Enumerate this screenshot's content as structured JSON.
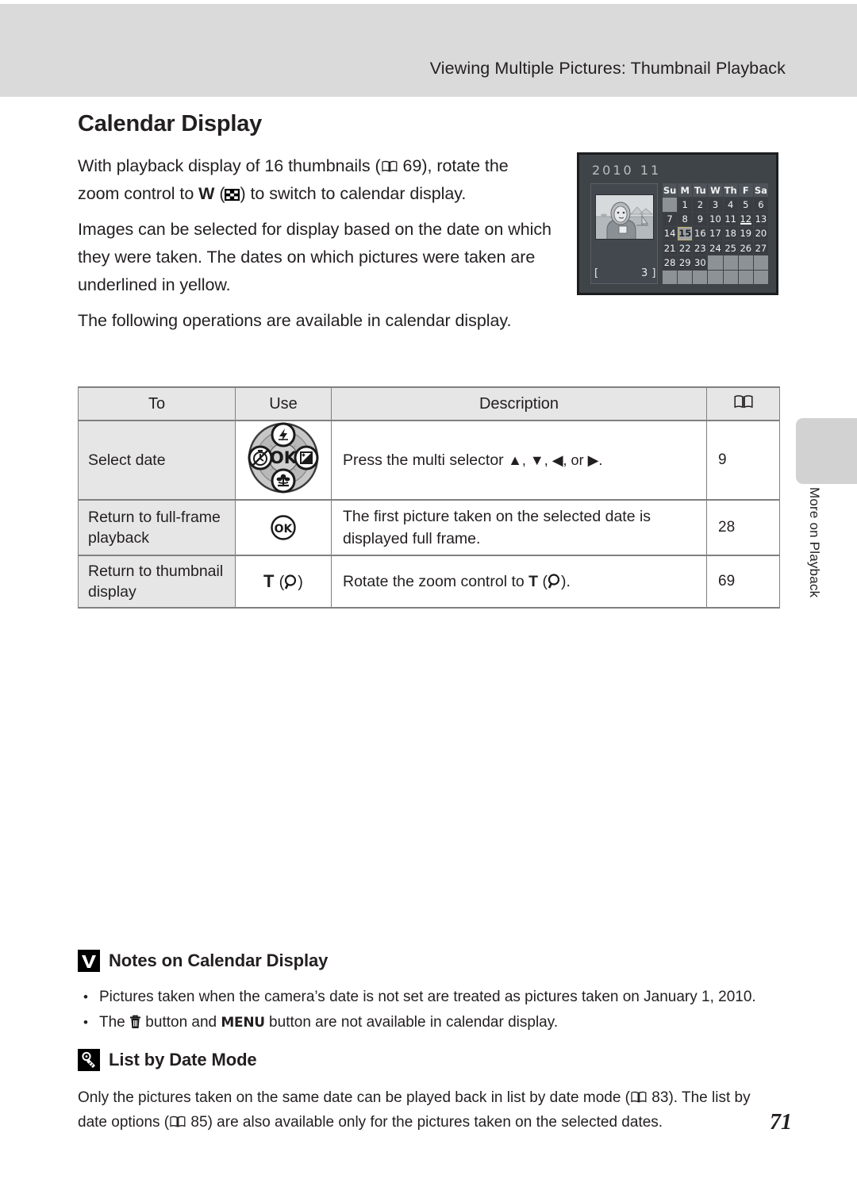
{
  "header": {
    "running_title": "Viewing Multiple Pictures: Thumbnail Playback"
  },
  "side_tab": {
    "label": "More on Playback"
  },
  "section": {
    "title": "Calendar Display",
    "paragraphs": [
      {
        "id": "p1",
        "pre": "With playback display of 16 thumbnails (",
        "bookref_page": "69",
        "mid": "), rotate the zoom control to ",
        "w_label": "W",
        "mid2": " (",
        "post": ") to switch to calendar display."
      },
      {
        "id": "p2",
        "text": "Images can be selected for display based on the date on which they were taken. The dates on which pictures were taken are underlined in yellow."
      },
      {
        "id": "p3",
        "text": "The following operations are available in calendar display."
      }
    ]
  },
  "camera_screenshot": {
    "year": "2010",
    "month": "11",
    "picture_count_open": "[",
    "picture_count": "3",
    "picture_count_close": "]",
    "weekday_headers": [
      "Su",
      "M",
      "Tu",
      "W",
      "Th",
      "F",
      "Sa"
    ],
    "leading_blanks": 1,
    "days": [
      1,
      2,
      3,
      4,
      5,
      6,
      7,
      8,
      9,
      10,
      11,
      12,
      13,
      14,
      15,
      16,
      17,
      18,
      19,
      20,
      21,
      22,
      23,
      24,
      25,
      26,
      27,
      28,
      29,
      30
    ],
    "selected_day": 15,
    "underlined_days": [
      12
    ],
    "total_cells": 49
  },
  "table": {
    "headers": [
      "To",
      "Use",
      "Description",
      "book-icon"
    ],
    "rows": [
      {
        "to": "Select date",
        "use_icon": "multi-selector-dial-icon",
        "use_label": "",
        "description_pre": "Press the multi selector ",
        "description_arrows": "▲, ▼, ◀, or ▶.",
        "ref": "9"
      },
      {
        "to": "Return to full-frame playback",
        "use_icon": "ok-button-icon",
        "use_label": "",
        "description_pre": "The first picture taken on the selected date is displayed full frame.",
        "description_arrows": "",
        "ref": "28"
      },
      {
        "to": "Return to thumbnail display",
        "use_icon": "zoom-tele-magnify-icon",
        "use_label": "T",
        "description_pre": "Rotate the zoom control to ",
        "description_arrows": "",
        "ref": "69"
      }
    ]
  },
  "notes": {
    "icon": "check-box-icon",
    "title": "Notes on Calendar Display",
    "bullets": [
      {
        "id": "b1",
        "text": "Pictures taken when the camera’s date is not set are treated as pictures taken on January 1, 2010."
      },
      {
        "id": "b2",
        "pre": "The ",
        "mid": " button and ",
        "menu_label": "MENU",
        "post": " button are not available in calendar display."
      }
    ]
  },
  "list_by_date": {
    "icon": "list-by-date-tag-icon",
    "title": "List by Date Mode",
    "pre": "Only the pictures taken on the same date can be played back in list by date mode (",
    "ref1": "83",
    "mid": "). The list by date options (",
    "ref2": "85",
    "post": ") are also available only for the pictures taken on the selected dates."
  },
  "page_number": "71",
  "colors": {
    "header_band": "#dadada",
    "side_tab": "#d2d2d2",
    "table_head": "#e6e6e6",
    "table_left_col": "#e6e6e6",
    "camera_body": "#3f4449",
    "text": "#231f20"
  }
}
